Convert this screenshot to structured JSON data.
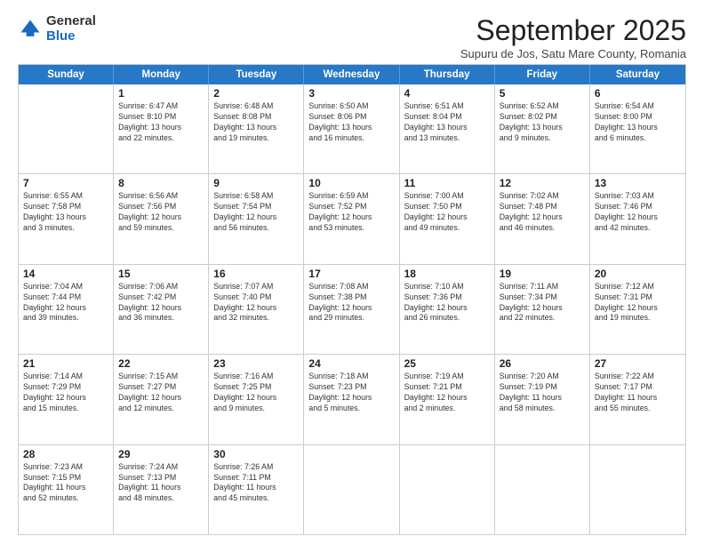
{
  "logo": {
    "general": "General",
    "blue": "Blue"
  },
  "title": "September 2025",
  "subtitle": "Supuru de Jos, Satu Mare County, Romania",
  "headers": [
    "Sunday",
    "Monday",
    "Tuesday",
    "Wednesday",
    "Thursday",
    "Friday",
    "Saturday"
  ],
  "weeks": [
    [
      {
        "day": "",
        "info": ""
      },
      {
        "day": "1",
        "info": "Sunrise: 6:47 AM\nSunset: 8:10 PM\nDaylight: 13 hours\nand 22 minutes."
      },
      {
        "day": "2",
        "info": "Sunrise: 6:48 AM\nSunset: 8:08 PM\nDaylight: 13 hours\nand 19 minutes."
      },
      {
        "day": "3",
        "info": "Sunrise: 6:50 AM\nSunset: 8:06 PM\nDaylight: 13 hours\nand 16 minutes."
      },
      {
        "day": "4",
        "info": "Sunrise: 6:51 AM\nSunset: 8:04 PM\nDaylight: 13 hours\nand 13 minutes."
      },
      {
        "day": "5",
        "info": "Sunrise: 6:52 AM\nSunset: 8:02 PM\nDaylight: 13 hours\nand 9 minutes."
      },
      {
        "day": "6",
        "info": "Sunrise: 6:54 AM\nSunset: 8:00 PM\nDaylight: 13 hours\nand 6 minutes."
      }
    ],
    [
      {
        "day": "7",
        "info": "Sunrise: 6:55 AM\nSunset: 7:58 PM\nDaylight: 13 hours\nand 3 minutes."
      },
      {
        "day": "8",
        "info": "Sunrise: 6:56 AM\nSunset: 7:56 PM\nDaylight: 12 hours\nand 59 minutes."
      },
      {
        "day": "9",
        "info": "Sunrise: 6:58 AM\nSunset: 7:54 PM\nDaylight: 12 hours\nand 56 minutes."
      },
      {
        "day": "10",
        "info": "Sunrise: 6:59 AM\nSunset: 7:52 PM\nDaylight: 12 hours\nand 53 minutes."
      },
      {
        "day": "11",
        "info": "Sunrise: 7:00 AM\nSunset: 7:50 PM\nDaylight: 12 hours\nand 49 minutes."
      },
      {
        "day": "12",
        "info": "Sunrise: 7:02 AM\nSunset: 7:48 PM\nDaylight: 12 hours\nand 46 minutes."
      },
      {
        "day": "13",
        "info": "Sunrise: 7:03 AM\nSunset: 7:46 PM\nDaylight: 12 hours\nand 42 minutes."
      }
    ],
    [
      {
        "day": "14",
        "info": "Sunrise: 7:04 AM\nSunset: 7:44 PM\nDaylight: 12 hours\nand 39 minutes."
      },
      {
        "day": "15",
        "info": "Sunrise: 7:06 AM\nSunset: 7:42 PM\nDaylight: 12 hours\nand 36 minutes."
      },
      {
        "day": "16",
        "info": "Sunrise: 7:07 AM\nSunset: 7:40 PM\nDaylight: 12 hours\nand 32 minutes."
      },
      {
        "day": "17",
        "info": "Sunrise: 7:08 AM\nSunset: 7:38 PM\nDaylight: 12 hours\nand 29 minutes."
      },
      {
        "day": "18",
        "info": "Sunrise: 7:10 AM\nSunset: 7:36 PM\nDaylight: 12 hours\nand 26 minutes."
      },
      {
        "day": "19",
        "info": "Sunrise: 7:11 AM\nSunset: 7:34 PM\nDaylight: 12 hours\nand 22 minutes."
      },
      {
        "day": "20",
        "info": "Sunrise: 7:12 AM\nSunset: 7:31 PM\nDaylight: 12 hours\nand 19 minutes."
      }
    ],
    [
      {
        "day": "21",
        "info": "Sunrise: 7:14 AM\nSunset: 7:29 PM\nDaylight: 12 hours\nand 15 minutes."
      },
      {
        "day": "22",
        "info": "Sunrise: 7:15 AM\nSunset: 7:27 PM\nDaylight: 12 hours\nand 12 minutes."
      },
      {
        "day": "23",
        "info": "Sunrise: 7:16 AM\nSunset: 7:25 PM\nDaylight: 12 hours\nand 9 minutes."
      },
      {
        "day": "24",
        "info": "Sunrise: 7:18 AM\nSunset: 7:23 PM\nDaylight: 12 hours\nand 5 minutes."
      },
      {
        "day": "25",
        "info": "Sunrise: 7:19 AM\nSunset: 7:21 PM\nDaylight: 12 hours\nand 2 minutes."
      },
      {
        "day": "26",
        "info": "Sunrise: 7:20 AM\nSunset: 7:19 PM\nDaylight: 11 hours\nand 58 minutes."
      },
      {
        "day": "27",
        "info": "Sunrise: 7:22 AM\nSunset: 7:17 PM\nDaylight: 11 hours\nand 55 minutes."
      }
    ],
    [
      {
        "day": "28",
        "info": "Sunrise: 7:23 AM\nSunset: 7:15 PM\nDaylight: 11 hours\nand 52 minutes."
      },
      {
        "day": "29",
        "info": "Sunrise: 7:24 AM\nSunset: 7:13 PM\nDaylight: 11 hours\nand 48 minutes."
      },
      {
        "day": "30",
        "info": "Sunrise: 7:26 AM\nSunset: 7:11 PM\nDaylight: 11 hours\nand 45 minutes."
      },
      {
        "day": "",
        "info": ""
      },
      {
        "day": "",
        "info": ""
      },
      {
        "day": "",
        "info": ""
      },
      {
        "day": "",
        "info": ""
      }
    ]
  ]
}
